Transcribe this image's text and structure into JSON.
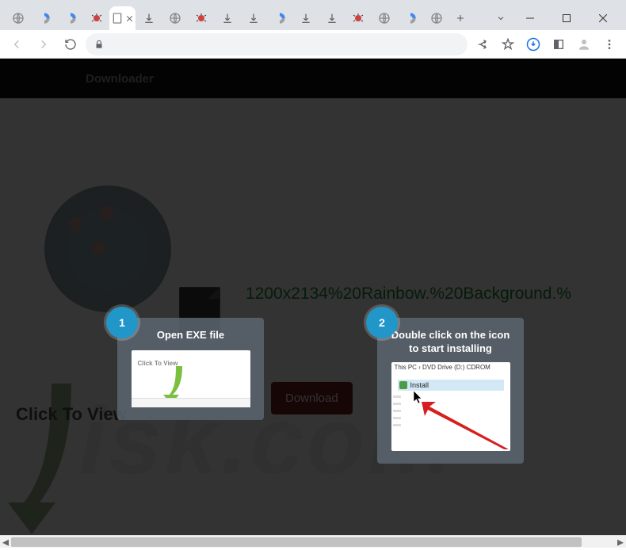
{
  "window": {
    "tabs": [
      {
        "icon": "globe"
      },
      {
        "icon": "recaptcha"
      },
      {
        "icon": "recaptcha"
      },
      {
        "icon": "bug"
      },
      {
        "icon": "page",
        "active": true,
        "close": true
      },
      {
        "icon": "download"
      },
      {
        "icon": "globe"
      },
      {
        "icon": "bug"
      },
      {
        "icon": "download"
      },
      {
        "icon": "download"
      },
      {
        "icon": "recaptcha"
      },
      {
        "icon": "download"
      },
      {
        "icon": "download"
      },
      {
        "icon": "bug"
      },
      {
        "icon": "globe"
      },
      {
        "icon": "recaptcha"
      },
      {
        "icon": "globe"
      }
    ],
    "controls": {
      "dropdown": "⌄",
      "new_tab": "+"
    }
  },
  "toolbar": {
    "lock": "secure"
  },
  "page": {
    "header_title": "Downloader",
    "filename": "1200x2134%20Rainbow.%20Background.%",
    "download_btn": "Download",
    "click_to_view": "Click To View",
    "watermark": "isk.com"
  },
  "cards": {
    "c1": {
      "num": "1",
      "title": "Open EXE file",
      "mini_label": "Click To View"
    },
    "c2": {
      "num": "2",
      "title": "Double click on the icon to start installing",
      "breadcrumb": "This PC  ›  DVD Drive (D:) CDROM",
      "install_label": "Install"
    }
  }
}
